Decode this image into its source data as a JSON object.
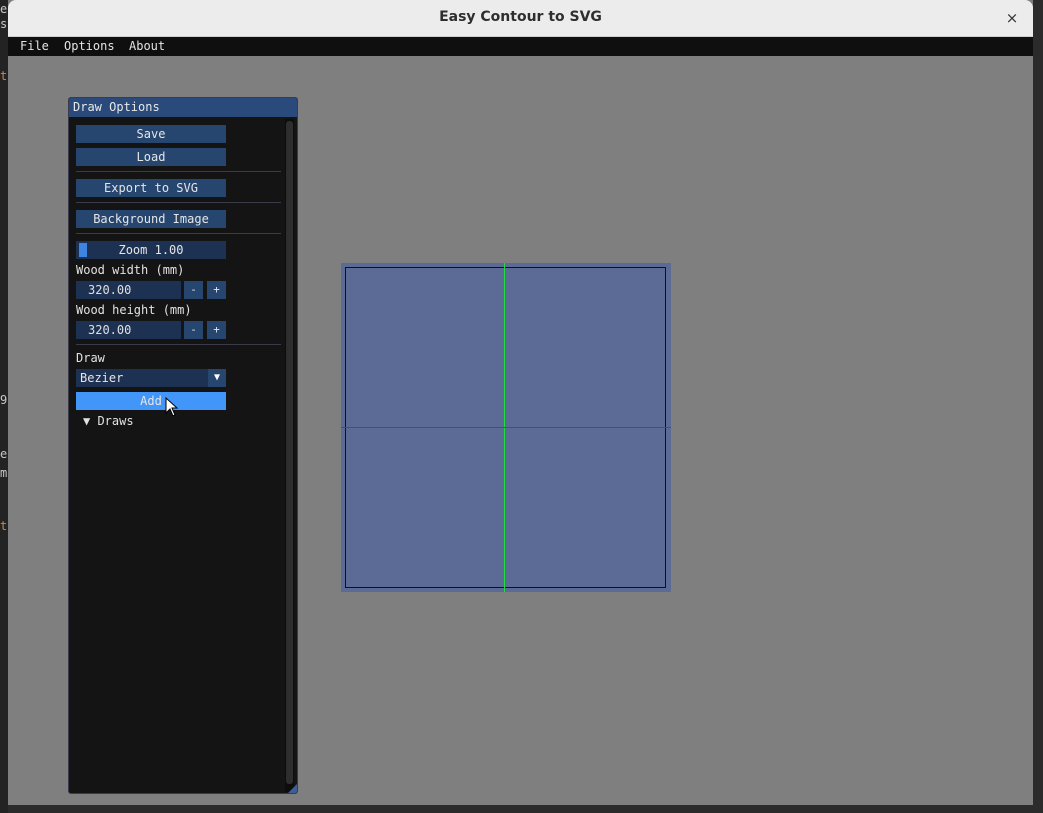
{
  "window": {
    "title": "Easy Contour to SVG",
    "close_glyph": "×"
  },
  "menubar": {
    "items": [
      "File",
      "Options",
      "About"
    ]
  },
  "background_chars": [
    {
      "text": "e",
      "color": "#c8c8c8"
    },
    {
      "text": "s",
      "color": "#c8c8c8"
    },
    {
      "text": "t",
      "color": "#c9884a"
    },
    {
      "text": "9",
      "color": "#c8c8c8"
    },
    {
      "text": "e",
      "color": "#c8c8c8"
    },
    {
      "text": "m",
      "color": "#c8c8c8"
    },
    {
      "text": "t",
      "color": "#c9884a"
    }
  ],
  "panel": {
    "title": "Draw Options",
    "save_label": "Save",
    "load_label": "Load",
    "export_label": "Export to SVG",
    "background_label": "Background Image",
    "zoom_label": "Zoom 1.00",
    "wood_width_label": "Wood width (mm)",
    "wood_width_value": "320.00",
    "wood_height_label": "Wood height (mm)",
    "wood_height_value": "320.00",
    "minus_label": "-",
    "plus_label": "+",
    "draw_label": "Draw",
    "draw_type_selected": "Bezier",
    "combo_arrow": "▼",
    "add_label": "Add",
    "draws_tree_label": "▼  Draws"
  },
  "colors": {
    "titlebar": "#ececec",
    "menubar": "#0f0f0f",
    "workspace": "#7f7f7f",
    "panel_title": "#294a7a",
    "button": "#26466f",
    "button_active": "#4296fa",
    "canvas_fill": "#5b6b96",
    "axis_x": "#d01a1a",
    "axis_y": "#1ee03a"
  }
}
